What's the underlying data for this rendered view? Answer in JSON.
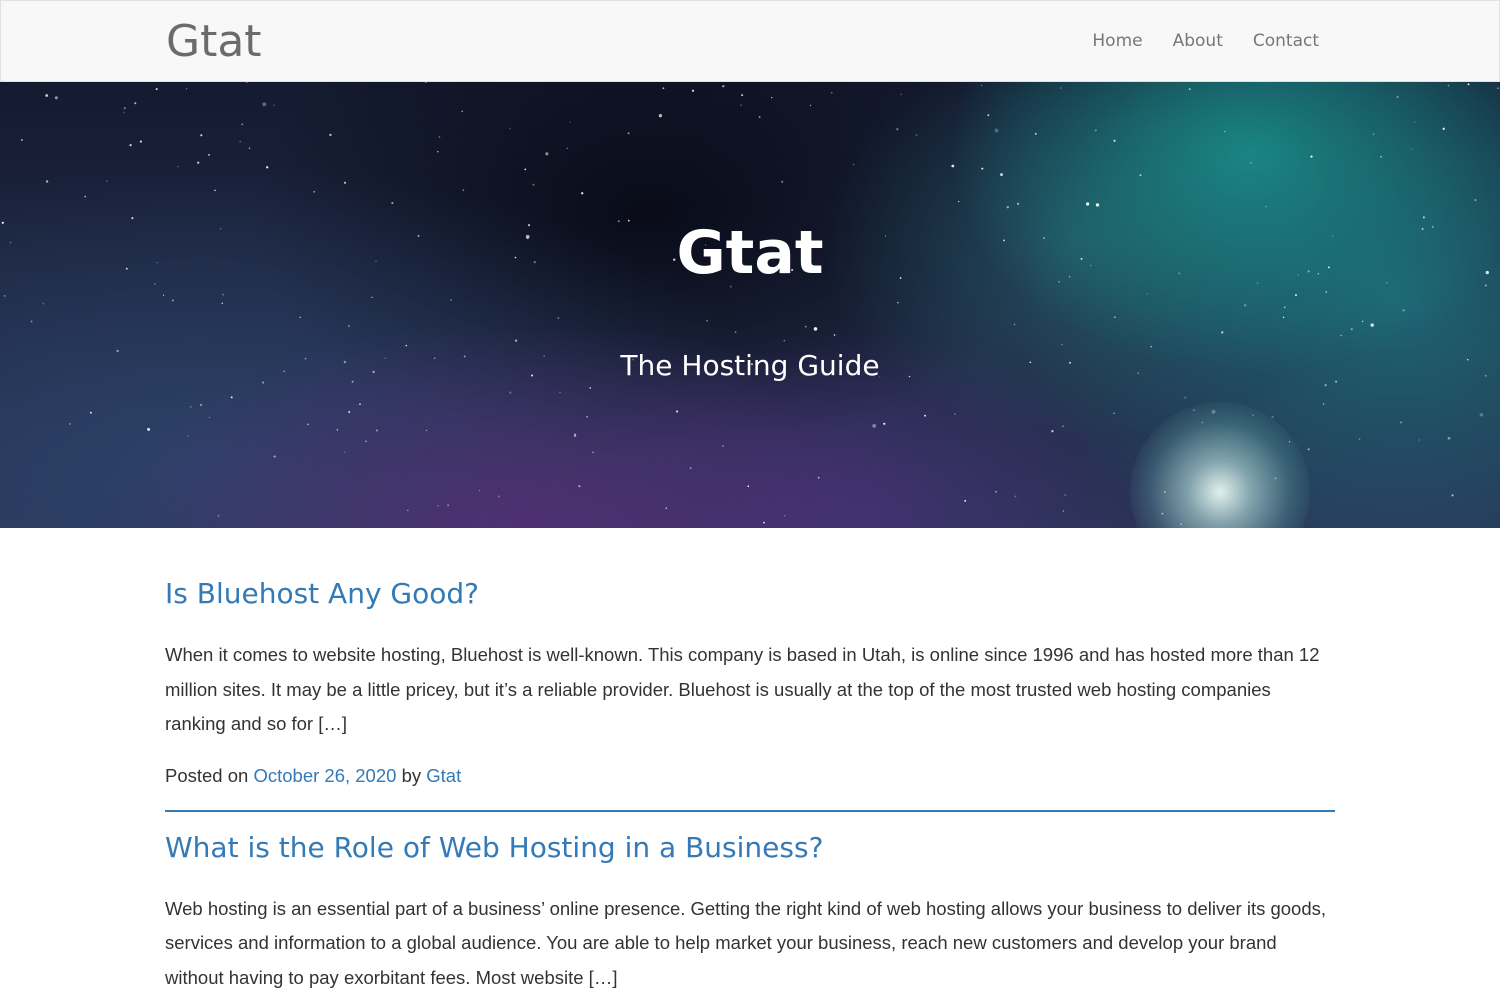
{
  "site": {
    "brand": "Gtat"
  },
  "nav": {
    "items": [
      {
        "label": "Home"
      },
      {
        "label": "About"
      },
      {
        "label": "Contact"
      }
    ]
  },
  "hero": {
    "title": "Gtat",
    "subtitle": "The Hosting Guide"
  },
  "posts": [
    {
      "title": "Is Bluehost Any Good?",
      "excerpt": "When it comes to website hosting, Bluehost is well-known. This company is based in Utah, is online since 1996 and has hosted more than 12 million sites. It may be a little pricey, but it’s a reliable provider. Bluehost is usually at the top of the most trusted web hosting companies ranking and so for […]",
      "meta_prefix": "Posted on",
      "date": "October 26, 2020",
      "meta_by": "by",
      "author": "Gtat"
    },
    {
      "title": "What is the Role of Web Hosting in a Business?",
      "excerpt": "Web hosting is an essential part of a business’ online presence. Getting the right kind of web hosting allows your business to deliver its goods, services and information to a global audience. You are able to help market your business, reach new customers and develop your brand without having to pay exorbitant fees. Most website […]"
    }
  ],
  "colors": {
    "link": "#337ab7",
    "text": "#333333",
    "navbar_bg": "#f8f8f8",
    "nav_text": "#777777"
  }
}
